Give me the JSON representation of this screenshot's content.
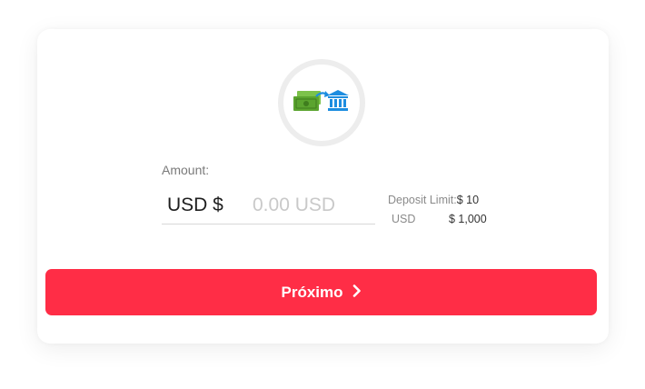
{
  "icon": {
    "name": "deposit-cash-to-bank-icon"
  },
  "amount": {
    "label": "Amount:",
    "currency_prefix": "USD $",
    "placeholder": "0.00 USD",
    "value": ""
  },
  "deposit_limit": {
    "caption": "Deposit Limit:",
    "min": "$ 10",
    "currency": "USD",
    "max": "$ 1,000"
  },
  "next_button": {
    "label": "Próximo",
    "color": "#ff2d46"
  },
  "colors": {
    "money_green": "#5ba42f",
    "bank_blue": "#1d8de0"
  }
}
